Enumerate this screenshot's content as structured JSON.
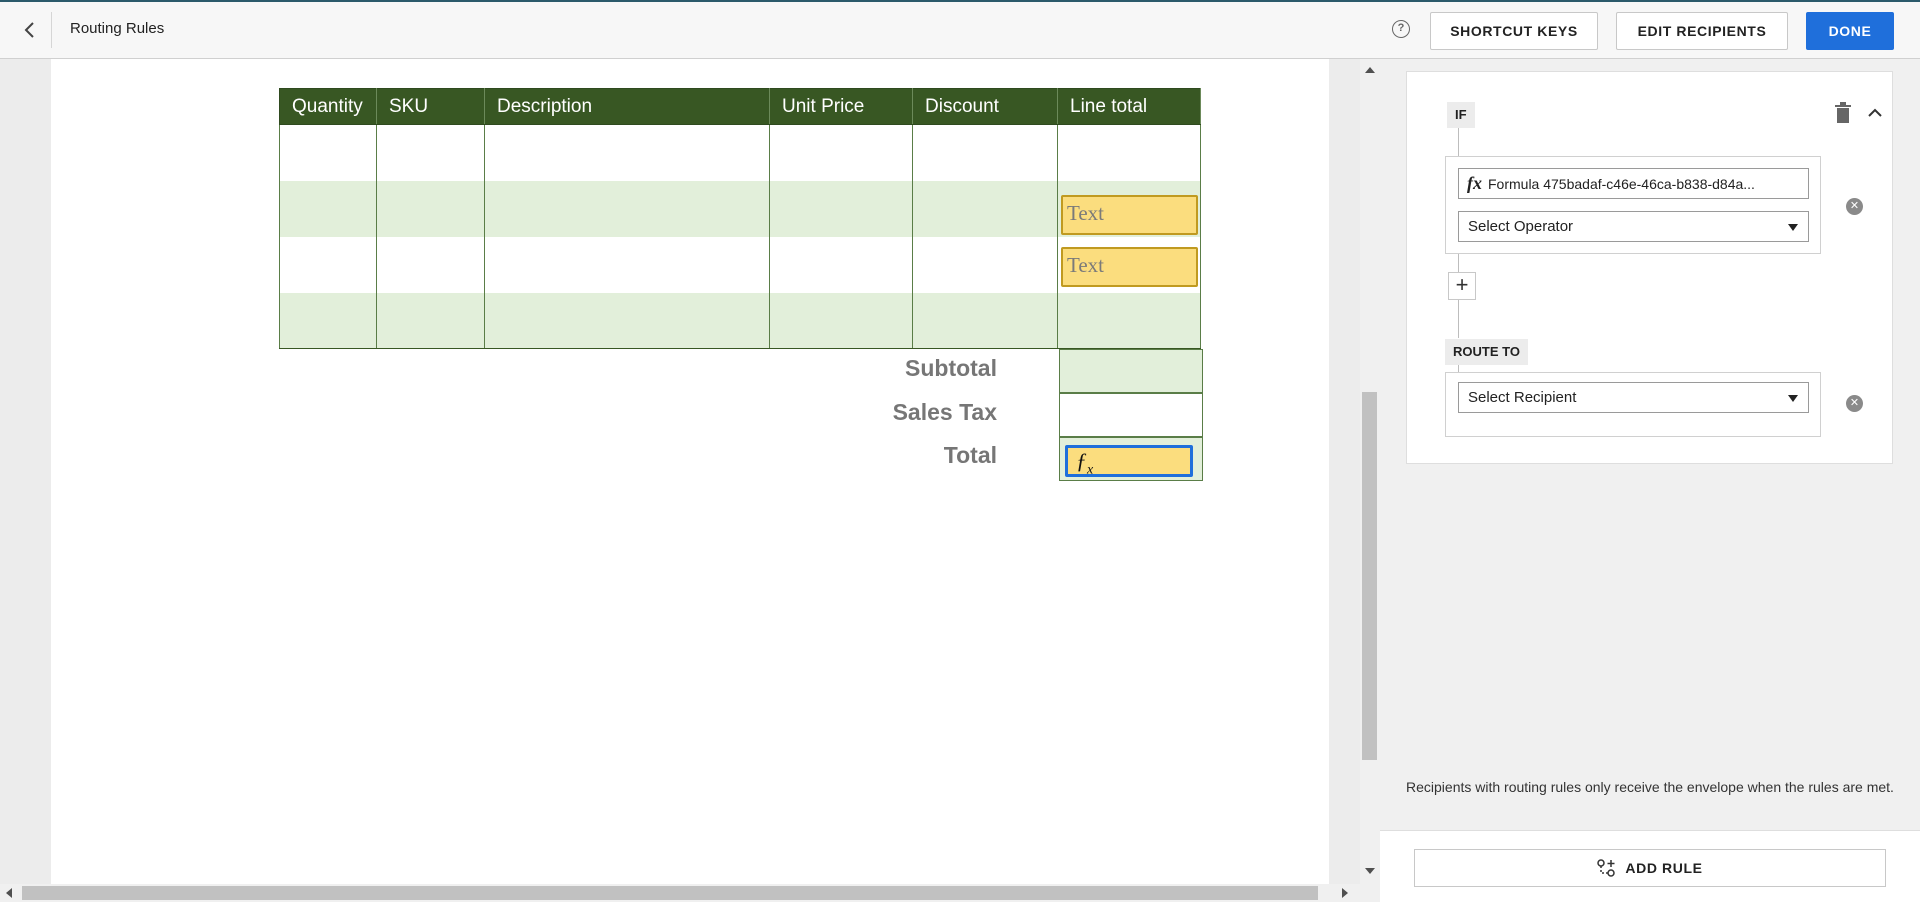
{
  "header": {
    "title": "Routing Rules",
    "help_icon": "help-circle-icon",
    "shortcut_keys": "SHORTCUT KEYS",
    "edit_recipients": "EDIT RECIPIENTS",
    "done": "DONE"
  },
  "document": {
    "table": {
      "headers": [
        "Quantity",
        "SKU",
        "Description",
        "Unit Price",
        "Discount",
        "Line total"
      ],
      "rows": 4
    },
    "text_fields": [
      "Text",
      "Text"
    ],
    "totals": {
      "subtotal": "Subtotal",
      "sales_tax": "Sales Tax",
      "total": "Total"
    },
    "formula_field_symbol": "fx"
  },
  "rule": {
    "if_label": "IF",
    "formula_text": "Formula 475badaf-c46e-46ca-b838-d84a...",
    "operator_placeholder": "Select Operator",
    "route_to_label": "ROUTE TO",
    "recipient_placeholder": "Select Recipient"
  },
  "panel": {
    "note": "Recipients with routing rules only receive the envelope when the rules are met.",
    "add_rule": "ADD RULE"
  },
  "colors": {
    "primary": "#1f6fdb",
    "table_header": "#385723",
    "table_alt_row": "#e2efda",
    "field_fill": "#fbdd7e"
  }
}
